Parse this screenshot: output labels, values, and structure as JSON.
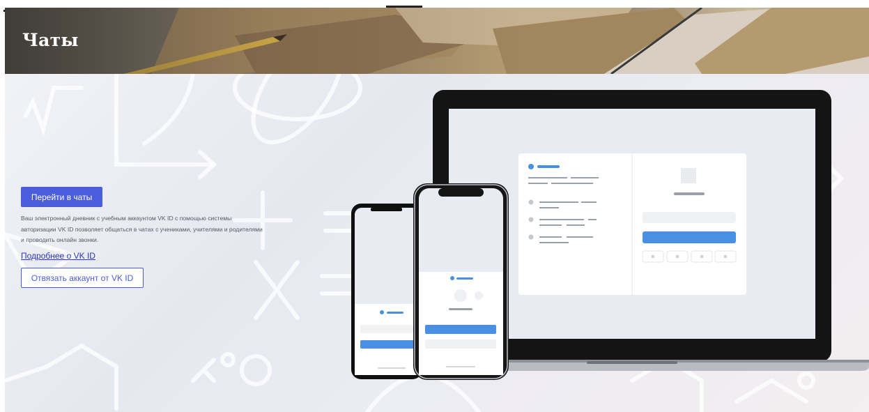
{
  "header": {
    "title": "Чаты"
  },
  "hero": {
    "cta_label": "Перейти в чаты",
    "description": "Ваш электронный дневник с учебным аккаунтом VK ID с помощью системы авторизации VK ID позволяет общаться в чатах с учениками, учителями и родителями и проводить онлайн звонки.",
    "more_link": "Подробнее о VK ID",
    "unlink_label": "Отвязать аккаунт от VK ID"
  },
  "colors": {
    "accent": "#4a5dda",
    "link": "#2a35c8",
    "illustration_blue": "#4a90e2"
  }
}
